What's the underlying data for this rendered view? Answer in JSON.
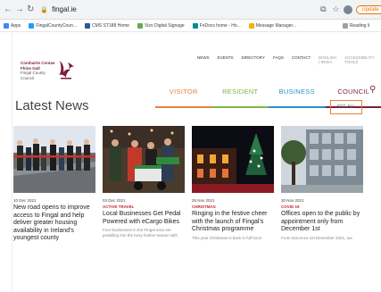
{
  "browser": {
    "url": "fingal.ie",
    "update_label": "Update"
  },
  "bookmarks": {
    "items": [
      "Apps",
      "FingalCountyCoun...",
      "CMS ST188 Home",
      "Vizo Digital Signage",
      "FnDocs home - Ho...",
      "Message Manager..."
    ],
    "reading_list": "Reading li"
  },
  "site": {
    "logo": {
      "line1": "Comhairle Contae",
      "line2": "Fhine Gall",
      "line3": "Fingal County",
      "line4": "Council"
    },
    "top_links": [
      "NEWS",
      "EVENTS",
      "DIRECTORY",
      "FAQS",
      "CONTACT",
      "ENGLISH | IRISH",
      "ACCESSIBILITY TOOLS"
    ],
    "main_nav": [
      "VISITOR",
      "RESIDENT",
      "BUSINESS",
      "COUNCIL"
    ],
    "news_heading": "Latest News",
    "see_all": "SEE ALL",
    "cards": [
      {
        "date": "10 Dec 2021",
        "tag": "",
        "title": "New road opens to improve access to Fingal and help deliver greater housing availability in Ireland's youngest county",
        "excerpt": ""
      },
      {
        "date": "03 Dec 2021",
        "tag": "ACTIVE TRAVEL",
        "title": "Local Businesses Get Pedal Powered with eCargo Bikes",
        "excerpt": "Four businesses in the Fingal area are pedalling into the busy festive season with"
      },
      {
        "date": "25 Nov 2021",
        "tag": "CHRISTMAS",
        "title": "Ringing in the festive cheer with the launch of Fingal's Christmas programme",
        "excerpt": "This year Christmas is back in full force"
      },
      {
        "date": "30 Nov 2021",
        "tag": "COVID 19",
        "title": "Offices open to the public by appointment only from December 1st",
        "excerpt": "From tomorrow 1st December 2021, our"
      }
    ]
  }
}
